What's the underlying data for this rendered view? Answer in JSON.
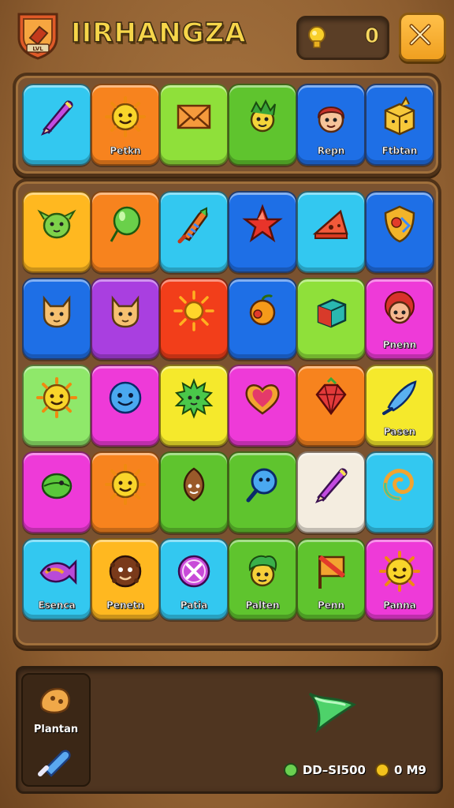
{
  "header": {
    "title": "IIRHANGZA",
    "coin_count": "0",
    "close_icon": "close-icon",
    "emblem_text": "LVL"
  },
  "colors": {
    "cyan": "#33c8f0",
    "orange": "#f7831e",
    "lime": "#8fe03a",
    "green": "#5fc42e",
    "blue": "#1e6fe6",
    "purple": "#a93fe0",
    "red": "#f23e1a",
    "magenta": "#ee3ad8",
    "yellow": "#f5e92c",
    "gold": "#ffb820",
    "cream": "#f4ede0",
    "lightgreen": "#8fe86a"
  },
  "top_row": [
    {
      "color": "cyan",
      "icon": "pencil-icon",
      "label": ""
    },
    {
      "color": "orange",
      "icon": "sun-face-icon",
      "label": "Petkn"
    },
    {
      "color": "lime",
      "icon": "envelope-icon",
      "label": ""
    },
    {
      "color": "green",
      "icon": "plant-creature-icon",
      "label": ""
    },
    {
      "color": "blue",
      "icon": "boy-face-icon",
      "label": "Repn"
    },
    {
      "color": "blue",
      "icon": "box-creature-icon",
      "label": "Ftbtan"
    }
  ],
  "grid": [
    [
      {
        "color": "gold",
        "icon": "green-creature-icon",
        "label": ""
      },
      {
        "color": "orange",
        "icon": "balloon-icon",
        "label": ""
      },
      {
        "color": "cyan",
        "icon": "rocket-icon",
        "label": ""
      },
      {
        "color": "blue",
        "icon": "star-icon",
        "label": ""
      },
      {
        "color": "cyan",
        "icon": "cheese-icon",
        "label": ""
      },
      {
        "color": "blue",
        "icon": "shield-icon",
        "label": ""
      }
    ],
    [
      {
        "color": "blue",
        "icon": "cat-face-icon",
        "label": ""
      },
      {
        "color": "purple",
        "icon": "cat-face-icon",
        "label": ""
      },
      {
        "color": "red",
        "icon": "sun-icon",
        "label": ""
      },
      {
        "color": "blue",
        "icon": "orange-fruit-icon",
        "label": ""
      },
      {
        "color": "lime",
        "icon": "cube-icon",
        "label": ""
      },
      {
        "color": "magenta",
        "icon": "girl-face-icon",
        "label": "Pnenn"
      }
    ],
    [
      {
        "color": "lightgreen",
        "icon": "sun-face-icon",
        "label": ""
      },
      {
        "color": "magenta",
        "icon": "smiley-blob-icon",
        "label": ""
      },
      {
        "color": "yellow",
        "icon": "spiky-creature-icon",
        "label": ""
      },
      {
        "color": "magenta",
        "icon": "heart-icon",
        "label": ""
      },
      {
        "color": "orange",
        "icon": "gem-icon",
        "label": ""
      },
      {
        "color": "yellow",
        "icon": "crystal-icon",
        "label": "Pasen"
      }
    ],
    [
      {
        "color": "magenta",
        "icon": "leaf-creature-icon",
        "label": ""
      },
      {
        "color": "orange",
        "icon": "sun-face-icon",
        "label": ""
      },
      {
        "color": "green",
        "icon": "seed-creature-icon",
        "label": ""
      },
      {
        "color": "green",
        "icon": "magnifier-icon",
        "label": ""
      },
      {
        "color": "cream",
        "icon": "pencil-icon",
        "label": ""
      },
      {
        "color": "cyan",
        "icon": "spiral-icon",
        "label": ""
      }
    ],
    [
      {
        "color": "cyan",
        "icon": "fish-icon",
        "label": "Esenca"
      },
      {
        "color": "gold",
        "icon": "cookie-face-icon",
        "label": "Penetn"
      },
      {
        "color": "cyan",
        "icon": "cross-circle-icon",
        "label": "Patia"
      },
      {
        "color": "green",
        "icon": "leaf-boy-icon",
        "label": "Palten"
      },
      {
        "color": "green",
        "icon": "flag-icon",
        "label": "Penn"
      },
      {
        "color": "magenta",
        "icon": "sun-face-icon",
        "label": "Panna"
      }
    ]
  ],
  "bottom": {
    "side_label": "Plantan",
    "stat_left": "DD–SI500",
    "stat_right": "0 M9"
  }
}
